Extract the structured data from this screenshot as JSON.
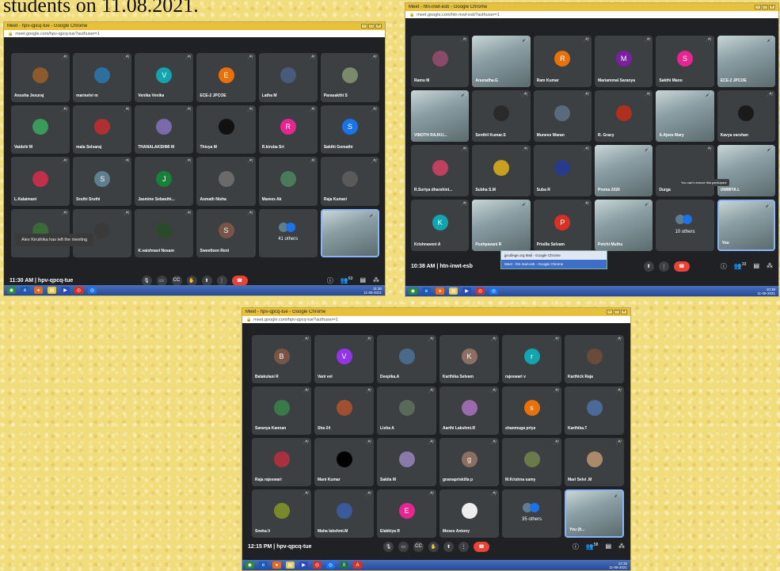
{
  "caption": "students on 11.08.2021.",
  "colors": {
    "accent_blue": "#1a73e8",
    "end_call": "#ea4335",
    "tile_bg": "#3c4043",
    "meet_bg": "#202124"
  },
  "shot1": {
    "window_title": "Meet - hpv-qpcq-tue - Google Chrome",
    "url": "meet.google.com/hpv-qpcq-tue?authuser=1",
    "meeting": "11:30 AM | hpv-qpcq-tue",
    "toast": "Alex Kiruthika has left the meeting",
    "people_count": "63",
    "tray_clock": "11:30\n11-08-2021",
    "tiles": [
      {
        "name": "Anusha Jesuraj",
        "initial": "",
        "color": "#8d5a2b"
      },
      {
        "name": "mariselvi m",
        "initial": "",
        "color": "#2d6f9e"
      },
      {
        "name": "Venika Venika",
        "initial": "V",
        "color": "#12a4af"
      },
      {
        "name": "ECE-2 JPCOE",
        "initial": "E",
        "color": "#e8710a"
      },
      {
        "name": "Latha M",
        "initial": "",
        "color": "#4a5a7a"
      },
      {
        "name": "Parasakthi S",
        "initial": "",
        "color": "#7a8a6a"
      },
      {
        "name": "Vaidehi M",
        "initial": "",
        "color": "#3a9a5a"
      },
      {
        "name": "mala Selvaraj",
        "initial": "",
        "color": "#b03030"
      },
      {
        "name": "THANALAKSHMI M",
        "initial": "",
        "color": "#7a6aaa"
      },
      {
        "name": "Thivya M",
        "initial": "",
        "color": "#111111"
      },
      {
        "name": "R.kiruba Sri",
        "initial": "R",
        "color": "#e52592"
      },
      {
        "name": "Sakthi Gomathi",
        "initial": "S",
        "color": "#1a73e8"
      },
      {
        "name": "L.Kalaimani",
        "initial": "",
        "color": "#c0304a"
      },
      {
        "name": "Sruthi Sruthi",
        "initial": "S",
        "color": "#5f7f8f"
      },
      {
        "name": "Jasmine Sebasthi...",
        "initial": "J",
        "color": "#188038"
      },
      {
        "name": "Asmath Nisha",
        "initial": "",
        "color": "#6a6a6a"
      },
      {
        "name": "Marees Ak",
        "initial": "",
        "color": "#4a7a5a"
      },
      {
        "name": "Raja Kumari",
        "initial": "",
        "color": "#5a5a5a"
      },
      {
        "name": "",
        "initial": "",
        "color": "#3a6a3a"
      },
      {
        "name": "",
        "initial": "",
        "color": "#3a3a3a"
      },
      {
        "name": "K.vaishnavi Nesam",
        "initial": "",
        "color": "#2a4a2a"
      },
      {
        "name": "Sweetleen Reni",
        "initial": "S",
        "color": "#795548"
      },
      {
        "name": "41 others",
        "initial": "",
        "color": ""
      },
      {
        "name": "",
        "initial": "",
        "color": "self"
      }
    ]
  },
  "shot2": {
    "window_title": "Meet - htn-inwt-esb - Google Chrome",
    "url": "meet.google.com/htn-inwt-esb?authuser=1",
    "meeting": "10:38 AM | htn-inwt-esb",
    "people_count": "33",
    "tooltip": "You can't remove this participant",
    "popup": [
      "jpcollege.org Mail - Google Chrome",
      "Meet - htn-inwt-esb - Google Chrome"
    ],
    "tray_clock": "10:38\n11-08-2021",
    "tiles": [
      {
        "name": "Ramu M",
        "initial": "",
        "color": "#8a4a6a"
      },
      {
        "name": "Anuradha.G",
        "initial": "",
        "color": "video"
      },
      {
        "name": "Ram Kumar",
        "initial": "R",
        "color": "#e8710a"
      },
      {
        "name": "Mariammal Saranya",
        "initial": "M",
        "color": "#7b1fa2"
      },
      {
        "name": "Sakthi Mano",
        "initial": "S",
        "color": "#e52592"
      },
      {
        "name": "ECE-2 JPCOE",
        "initial": "",
        "color": "video"
      },
      {
        "name": "VINOTH RAJKU...",
        "initial": "",
        "color": "video"
      },
      {
        "name": "Senthil Kumar.S",
        "initial": "",
        "color": "#2a2a2a"
      },
      {
        "name": "Munees Waran",
        "initial": "",
        "color": "#5a6a7a"
      },
      {
        "name": "R. Gracy",
        "initial": "",
        "color": "#b03020"
      },
      {
        "name": "A.Ajees Mary",
        "initial": "",
        "color": "video"
      },
      {
        "name": "Kavya varshan",
        "initial": "",
        "color": "#1a1a1a"
      },
      {
        "name": "R.Suriya dharshini...",
        "initial": "",
        "color": "#c04060"
      },
      {
        "name": "Subha S.M",
        "initial": "",
        "color": "#c8a020"
      },
      {
        "name": "Suba R",
        "initial": "",
        "color": "#2a3a8a"
      },
      {
        "name": "Prema 2020",
        "initial": "",
        "color": "video"
      },
      {
        "name": "Durga",
        "initial": "",
        "color": "#3c4043"
      },
      {
        "name": "UWMIYA L",
        "initial": "",
        "color": "video"
      },
      {
        "name": "Krishnaveni A",
        "initial": "K",
        "color": "#12a4af"
      },
      {
        "name": "Pushpavani R",
        "initial": "",
        "color": "video"
      },
      {
        "name": "Prisilla Selvam",
        "initial": "P",
        "color": "#d93025"
      },
      {
        "name": "Petchi Muthu",
        "initial": "",
        "color": "video"
      },
      {
        "name": "10 others",
        "initial": "",
        "color": ""
      },
      {
        "name": "You",
        "initial": "",
        "color": "self"
      }
    ]
  },
  "shot3": {
    "window_title": "Meet - hpv-qpcq-tue - Google Chrome",
    "url": "meet.google.com/hpv-qpcq-tue?authuser=1",
    "meeting": "12:15 PM | hpv-qpcq-tue",
    "people_count": "58",
    "tray_clock": "12:15\n11-08-2021",
    "tiles": [
      {
        "name": "Balakulasi R",
        "initial": "B",
        "color": "#795548"
      },
      {
        "name": "Vani vel",
        "initial": "V",
        "color": "#9334e6"
      },
      {
        "name": "Deepika.A",
        "initial": "",
        "color": "#4a6a8a"
      },
      {
        "name": "Karthika Selvam",
        "initial": "K",
        "color": "#8d6e63"
      },
      {
        "name": "rajeswari v",
        "initial": "r",
        "color": "#12a4af"
      },
      {
        "name": "Karthick Raja",
        "initial": "",
        "color": "#6a4a3a"
      },
      {
        "name": "Saranya Kannan",
        "initial": "",
        "color": "#3a7a4a"
      },
      {
        "name": "Sha 24",
        "initial": "",
        "color": "#a05030"
      },
      {
        "name": "Lisha A",
        "initial": "",
        "color": "#5a6a5a"
      },
      {
        "name": "Aarthi Lakshmi.R",
        "initial": "",
        "color": "#9a6aaa"
      },
      {
        "name": "shanmuga priya",
        "initial": "s",
        "color": "#e8710a"
      },
      {
        "name": "Karthika.T",
        "initial": "",
        "color": "#4a6a9a"
      },
      {
        "name": "Raja rajeswari",
        "initial": "",
        "color": "#aa3040"
      },
      {
        "name": "Mani Kumar",
        "initial": "",
        "color": "#000000"
      },
      {
        "name": "Sakila M",
        "initial": "",
        "color": "#8a7aaa"
      },
      {
        "name": "gnanapriskilla p",
        "initial": "g",
        "color": "#8d6e63"
      },
      {
        "name": "M.Krishna samy",
        "initial": "",
        "color": "#6a7a4a"
      },
      {
        "name": "Mari Selvi .M",
        "initial": "",
        "color": "#aa8a6a"
      },
      {
        "name": "Sneka.V",
        "initial": "",
        "color": "#7a8a2a"
      },
      {
        "name": "Maha lakshmi.M",
        "initial": "",
        "color": "#3a5a9a"
      },
      {
        "name": "Elakkiya R",
        "initial": "E",
        "color": "#e52592"
      },
      {
        "name": "Moses Antony",
        "initial": "",
        "color": "#eeeeee"
      },
      {
        "name": "35 others",
        "initial": "",
        "color": ""
      },
      {
        "name": "You (It...",
        "initial": "",
        "color": "self"
      }
    ]
  }
}
